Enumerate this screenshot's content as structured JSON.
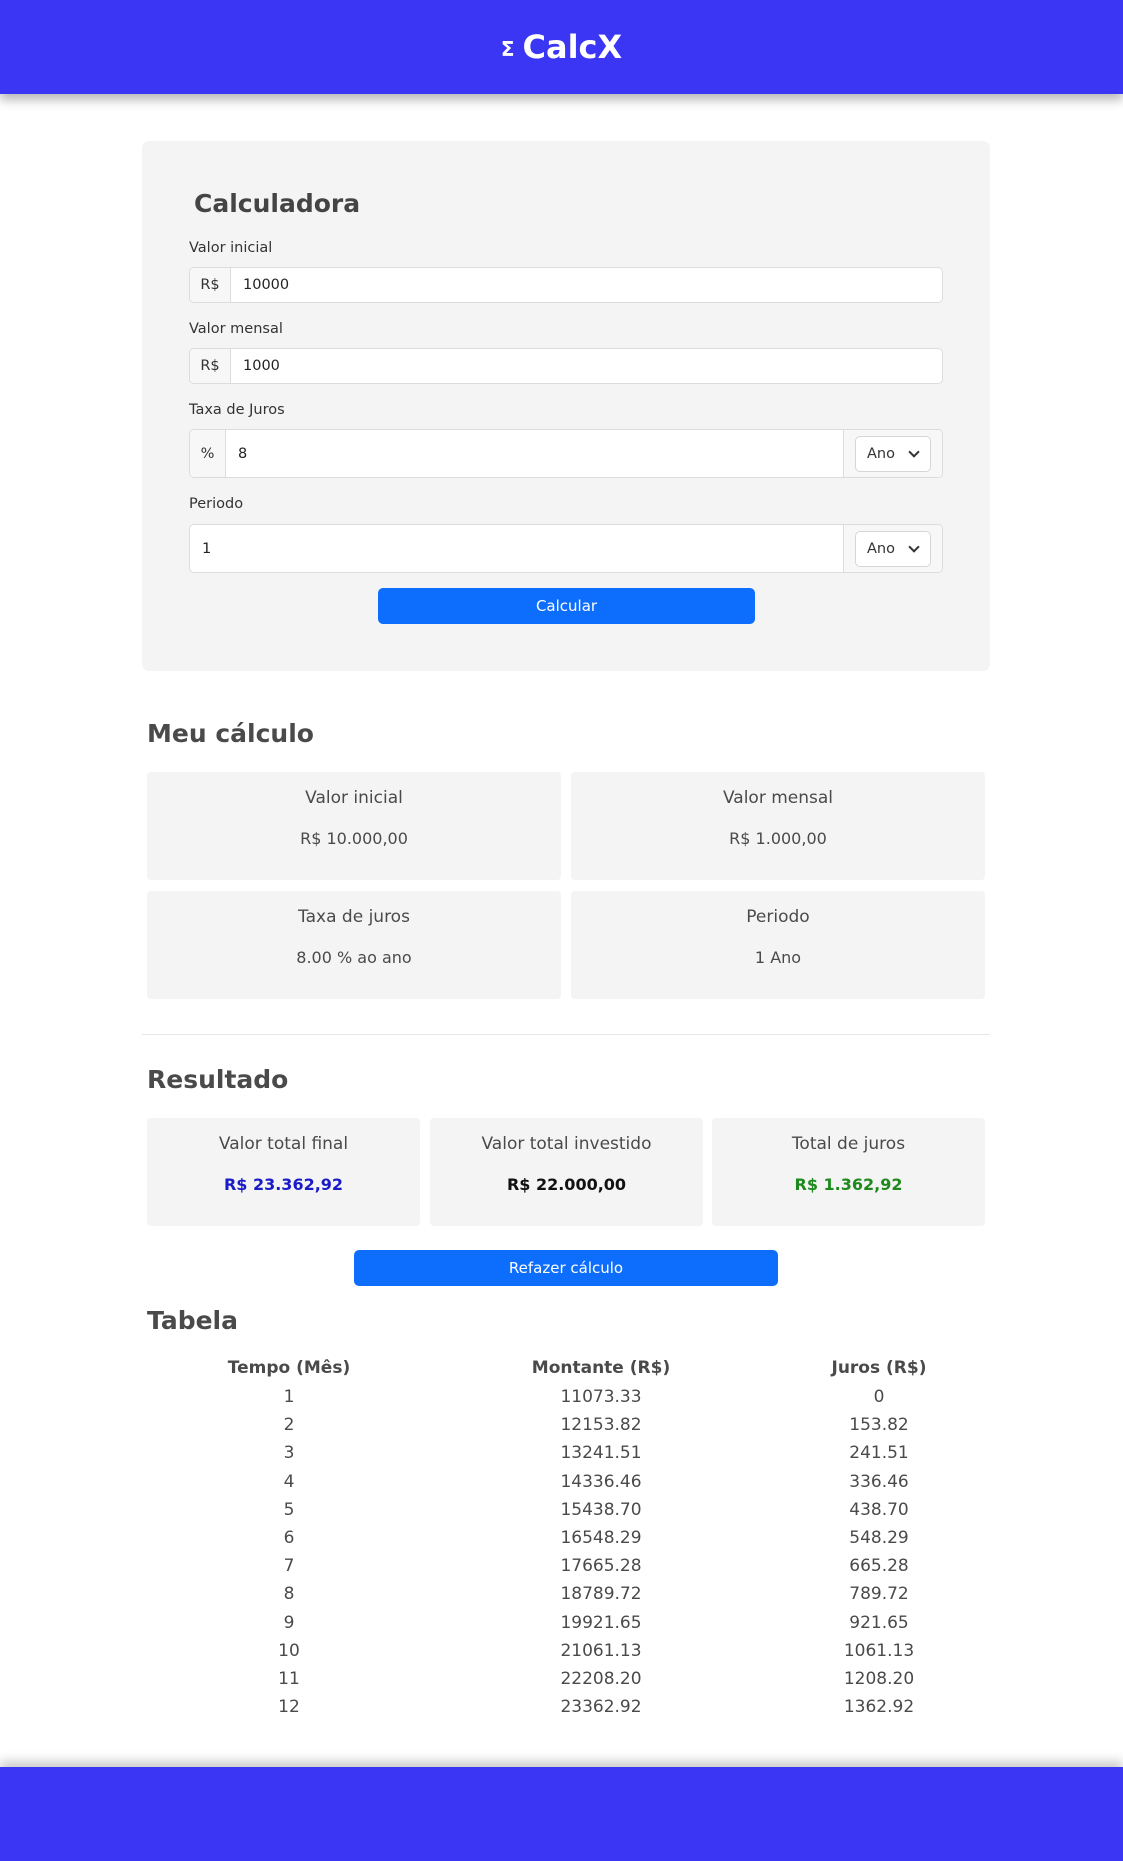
{
  "header": {
    "logo_symbol": "Σ",
    "logo_text": "CalcX",
    "brand_color": "#3a36f4"
  },
  "calculator": {
    "title": "Calculadora",
    "initial": {
      "label": "Valor inicial",
      "prefix": "R$",
      "value": "10000"
    },
    "monthly": {
      "label": "Valor mensal",
      "prefix": "R$",
      "value": "1000"
    },
    "rate": {
      "label": "Taxa de Juros",
      "prefix": "%",
      "value": "8",
      "unit": "Ano"
    },
    "period": {
      "label": "Periodo",
      "value": "1",
      "unit": "Ano"
    },
    "submit_label": "Calcular"
  },
  "summary": {
    "title": "Meu cálculo",
    "initial": {
      "label": "Valor inicial",
      "value": "R$ 10.000,00"
    },
    "monthly": {
      "label": "Valor mensal",
      "value": "R$ 1.000,00"
    },
    "rate": {
      "label": "Taxa de juros",
      "value": "8.00 % ao ano"
    },
    "period": {
      "label": "Periodo",
      "value": "1 Ano"
    }
  },
  "result": {
    "title": "Resultado",
    "final": {
      "label": "Valor total final",
      "value": "R$ 23.362,92",
      "color": "#1a1ac8"
    },
    "invested": {
      "label": "Valor total investido",
      "value": "R$ 22.000,00",
      "color": "#111111"
    },
    "interest": {
      "label": "Total de juros",
      "value": "R$ 1.362,92",
      "color": "#1e8a1e"
    },
    "redo_label": "Refazer cálculo"
  },
  "table": {
    "title": "Tabela",
    "headers": [
      "Tempo (Mês)",
      "Montante (R$)",
      "Juros (R$)"
    ],
    "rows": [
      [
        "1",
        "11073.33",
        "0"
      ],
      [
        "2",
        "12153.82",
        "153.82"
      ],
      [
        "3",
        "13241.51",
        "241.51"
      ],
      [
        "4",
        "14336.46",
        "336.46"
      ],
      [
        "5",
        "15438.70",
        "438.70"
      ],
      [
        "6",
        "16548.29",
        "548.29"
      ],
      [
        "7",
        "17665.28",
        "665.28"
      ],
      [
        "8",
        "18789.72",
        "789.72"
      ],
      [
        "9",
        "19921.65",
        "921.65"
      ],
      [
        "10",
        "21061.13",
        "1061.13"
      ],
      [
        "11",
        "22208.20",
        "1208.20"
      ],
      [
        "12",
        "23362.92",
        "1362.92"
      ]
    ]
  }
}
